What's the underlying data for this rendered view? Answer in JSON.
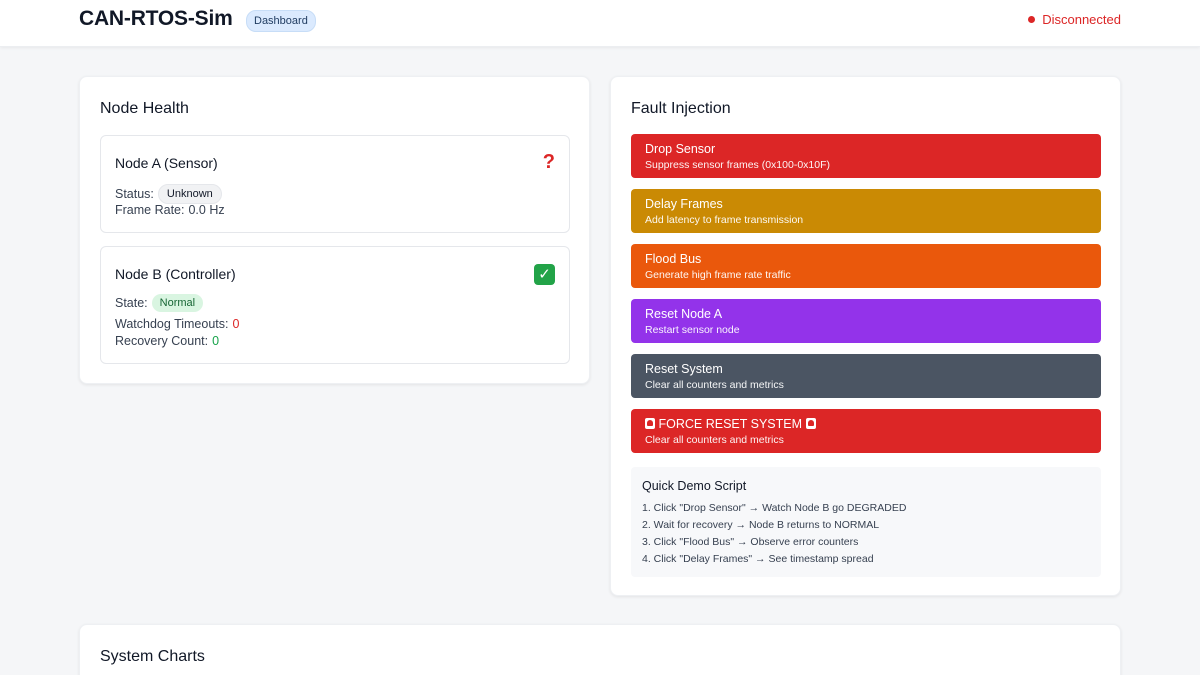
{
  "header": {
    "app_title": "CAN-RTOS-Sim",
    "nav_badge": "Dashboard",
    "connection_status": "Disconnected"
  },
  "node_health": {
    "title": "Node Health",
    "node_a": {
      "name": "Node A (Sensor)",
      "icon": "question-mark-icon",
      "status_label": "Status:",
      "status_value": "Unknown",
      "frame_rate_label": "Frame Rate:",
      "frame_rate_value": "0.0 Hz"
    },
    "node_b": {
      "name": "Node B (Controller)",
      "icon": "check-mark-icon",
      "state_label": "State:",
      "state_value": "Normal",
      "watchdog_label": "Watchdog Timeouts:",
      "watchdog_value": "0",
      "recovery_label": "Recovery Count:",
      "recovery_value": "0"
    }
  },
  "fault_injection": {
    "title": "Fault Injection",
    "buttons": [
      {
        "title": "Drop Sensor",
        "desc": "Suppress sensor frames (0x100-0x10F)",
        "color": "#dc2626"
      },
      {
        "title": "Delay Frames",
        "desc": "Add latency to frame transmission",
        "color": "#ca8a04"
      },
      {
        "title": "Flood Bus",
        "desc": "Generate high frame rate traffic",
        "color": "#ea580c"
      },
      {
        "title": "Reset Node A",
        "desc": "Restart sensor node",
        "color": "#9333ea"
      },
      {
        "title": "Reset System",
        "desc": "Clear all counters and metrics",
        "color": "#4b5563"
      },
      {
        "title": "FORCE RESET SYSTEM",
        "desc": "Clear all counters and metrics",
        "color": "#dc2626",
        "icon": "siren-icon"
      }
    ],
    "demo": {
      "title": "Quick Demo Script",
      "steps": [
        "1. Click \"Drop Sensor\" → Watch Node B go DEGRADED",
        "2. Wait for recovery → Node B returns to NORMAL",
        "3. Click \"Flood Bus\" → Observe error counters",
        "4. Click \"Delay Frames\" → See timestamp spread"
      ]
    }
  },
  "system_charts": {
    "title": "System Charts"
  }
}
